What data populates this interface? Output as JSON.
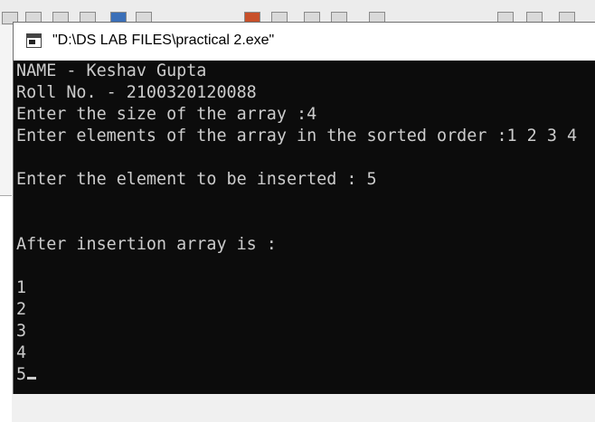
{
  "window": {
    "title": "\"D:\\DS LAB FILES\\practical 2.exe\"",
    "icon": "console-app-icon"
  },
  "console": {
    "lines": [
      "NAME - Keshav Gupta",
      "Roll No. - 2100320120088",
      "Enter the size of the array :4",
      "Enter elements of the array in the sorted order :1 2 3 4",
      "",
      "Enter the element to be inserted : 5",
      "",
      "",
      "After insertion array is :",
      "",
      "1",
      "2",
      "3",
      "4",
      "5"
    ]
  },
  "colors": {
    "console_background": "#0c0c0c",
    "console_text": "#cccccc",
    "titlebar": "#ffffff"
  }
}
